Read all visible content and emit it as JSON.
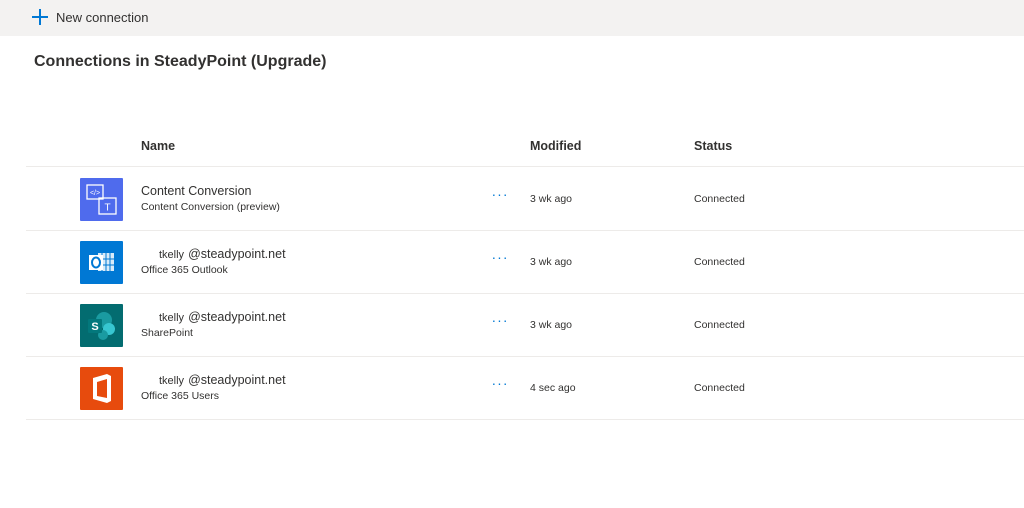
{
  "command_bar": {
    "new_connection_label": "New connection"
  },
  "page_title": "Connections in SteadyPoint (Upgrade)",
  "table": {
    "columns": {
      "name": "Name",
      "modified": "Modified",
      "status": "Status"
    },
    "more_label": "···",
    "rows": [
      {
        "icon": "content-conversion-icon",
        "icon_color": "#4f6bed",
        "user": "",
        "name": "Content Conversion",
        "connector": "Content Conversion (preview)",
        "modified": "3 wk ago",
        "status": "Connected"
      },
      {
        "icon": "outlook-icon",
        "icon_color": "#0078d4",
        "user": "tkelly",
        "name": "@steadypoint.net",
        "connector": "Office 365 Outlook",
        "modified": "3 wk ago",
        "status": "Connected"
      },
      {
        "icon": "sharepoint-icon",
        "icon_color": "#036c70",
        "user": "tkelly",
        "name": "@steadypoint.net",
        "connector": "SharePoint",
        "modified": "3 wk ago",
        "status": "Connected"
      },
      {
        "icon": "office-icon",
        "icon_color": "#e74b0d",
        "user": "tkelly",
        "name": "@steadypoint.net",
        "connector": "Office 365 Users",
        "modified": "4 sec ago",
        "status": "Connected"
      }
    ]
  }
}
